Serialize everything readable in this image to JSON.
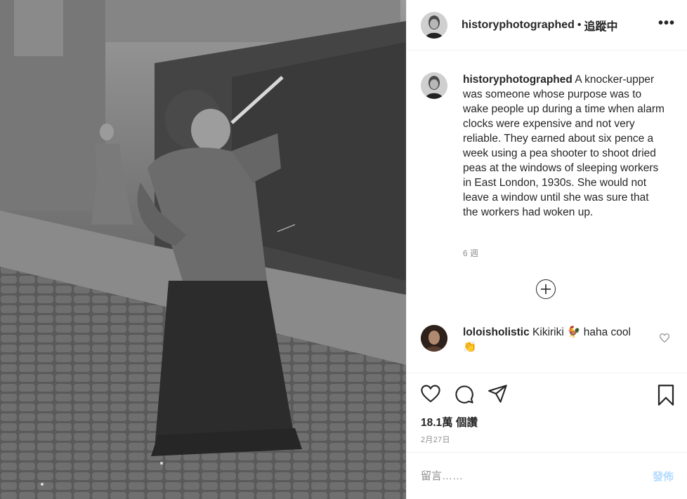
{
  "post": {
    "photo_alt": "Black and white photo of a woman using a pea shooter on a cobbled street",
    "author": {
      "username": "historyphotographed",
      "follow_status": "追蹤中",
      "avatar_icon": "portrait-avatar"
    },
    "more_icon": "more-options-icon",
    "caption": {
      "username": "historyphotographed",
      "text": "A knocker-upper was someone whose purpose was to wake people up during a time when alarm clocks were expensive and not very reliable. They earned about six pence a week using a pea shooter to shoot dried peas at the windows of sleeping workers in East London, 1930s. She would not leave a window until she was sure that the workers had woken up.",
      "time_ago": "6 週"
    },
    "load_more_icon": "plus-circle-icon",
    "comments": [
      {
        "username": "loloisholistic",
        "text": "Kikiriki 🐓 haha cool 👏",
        "avatar_icon": "user-avatar"
      }
    ],
    "actions": {
      "like_icon": "heart-icon",
      "comment_icon": "comment-icon",
      "share_icon": "share-icon",
      "save_icon": "bookmark-icon"
    },
    "views": "18.1萬 個讚",
    "date": "2月27日",
    "comment_input": {
      "placeholder": "留言……",
      "value": ""
    },
    "post_button": "發佈",
    "colors": {
      "post_button_disabled": "#b3dbff",
      "muted_text": "#8e8e8e",
      "border": "#efefef"
    }
  }
}
